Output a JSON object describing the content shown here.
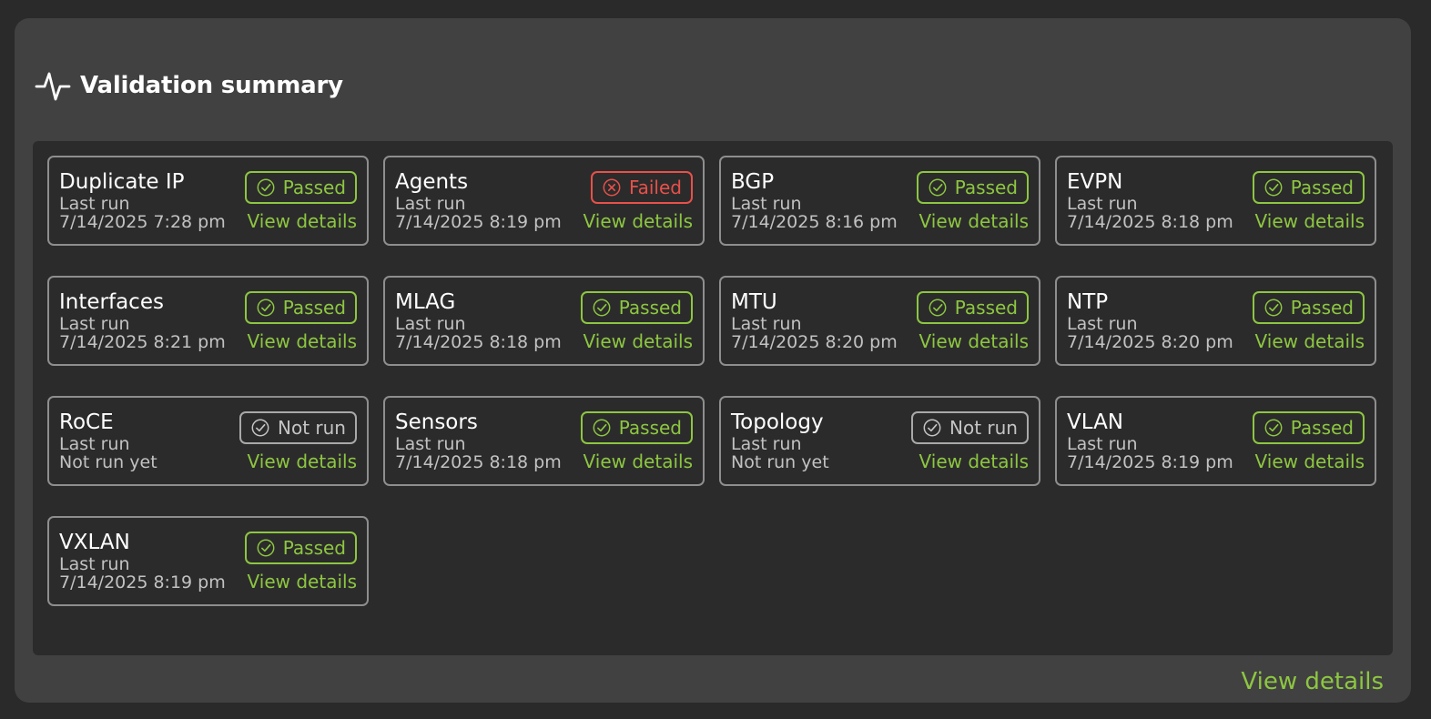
{
  "header": {
    "title": "Validation summary",
    "icon": "activity-pulse-icon"
  },
  "colors": {
    "passed": "#8dc641",
    "failed": "#e8504a",
    "not_run": "#c4c4c4",
    "link": "#8dc641"
  },
  "cards": [
    {
      "name": "Duplicate IP",
      "last_run_label": "Last run",
      "last_run": "7/14/2025 7:28 pm",
      "status": "passed",
      "status_label": "Passed",
      "link": "View details"
    },
    {
      "name": "Agents",
      "last_run_label": "Last run",
      "last_run": "7/14/2025 8:19 pm",
      "status": "failed",
      "status_label": "Failed",
      "link": "View details"
    },
    {
      "name": "BGP",
      "last_run_label": "Last run",
      "last_run": "7/14/2025 8:16 pm",
      "status": "passed",
      "status_label": "Passed",
      "link": "View details"
    },
    {
      "name": "EVPN",
      "last_run_label": "Last run",
      "last_run": "7/14/2025 8:18 pm",
      "status": "passed",
      "status_label": "Passed",
      "link": "View details"
    },
    {
      "name": "Interfaces",
      "last_run_label": "Last run",
      "last_run": "7/14/2025 8:21 pm",
      "status": "passed",
      "status_label": "Passed",
      "link": "View details"
    },
    {
      "name": "MLAG",
      "last_run_label": "Last run",
      "last_run": "7/14/2025 8:18 pm",
      "status": "passed",
      "status_label": "Passed",
      "link": "View details"
    },
    {
      "name": "MTU",
      "last_run_label": "Last run",
      "last_run": "7/14/2025 8:20 pm",
      "status": "passed",
      "status_label": "Passed",
      "link": "View details"
    },
    {
      "name": "NTP",
      "last_run_label": "Last run",
      "last_run": "7/14/2025 8:20 pm",
      "status": "passed",
      "status_label": "Passed",
      "link": "View details"
    },
    {
      "name": "RoCE",
      "last_run_label": "Last run",
      "last_run": "Not run yet",
      "status": "notrun",
      "status_label": "Not run",
      "link": "View details"
    },
    {
      "name": "Sensors",
      "last_run_label": "Last run",
      "last_run": "7/14/2025 8:18 pm",
      "status": "passed",
      "status_label": "Passed",
      "link": "View details"
    },
    {
      "name": "Topology",
      "last_run_label": "Last run",
      "last_run": "Not run yet",
      "status": "notrun",
      "status_label": "Not run",
      "link": "View details"
    },
    {
      "name": "VLAN",
      "last_run_label": "Last run",
      "last_run": "7/14/2025 8:19 pm",
      "status": "passed",
      "status_label": "Passed",
      "link": "View details"
    },
    {
      "name": "VXLAN",
      "last_run_label": "Last run",
      "last_run": "7/14/2025 8:19 pm",
      "status": "passed",
      "status_label": "Passed",
      "link": "View details"
    }
  ],
  "footer": {
    "link": "View details"
  }
}
